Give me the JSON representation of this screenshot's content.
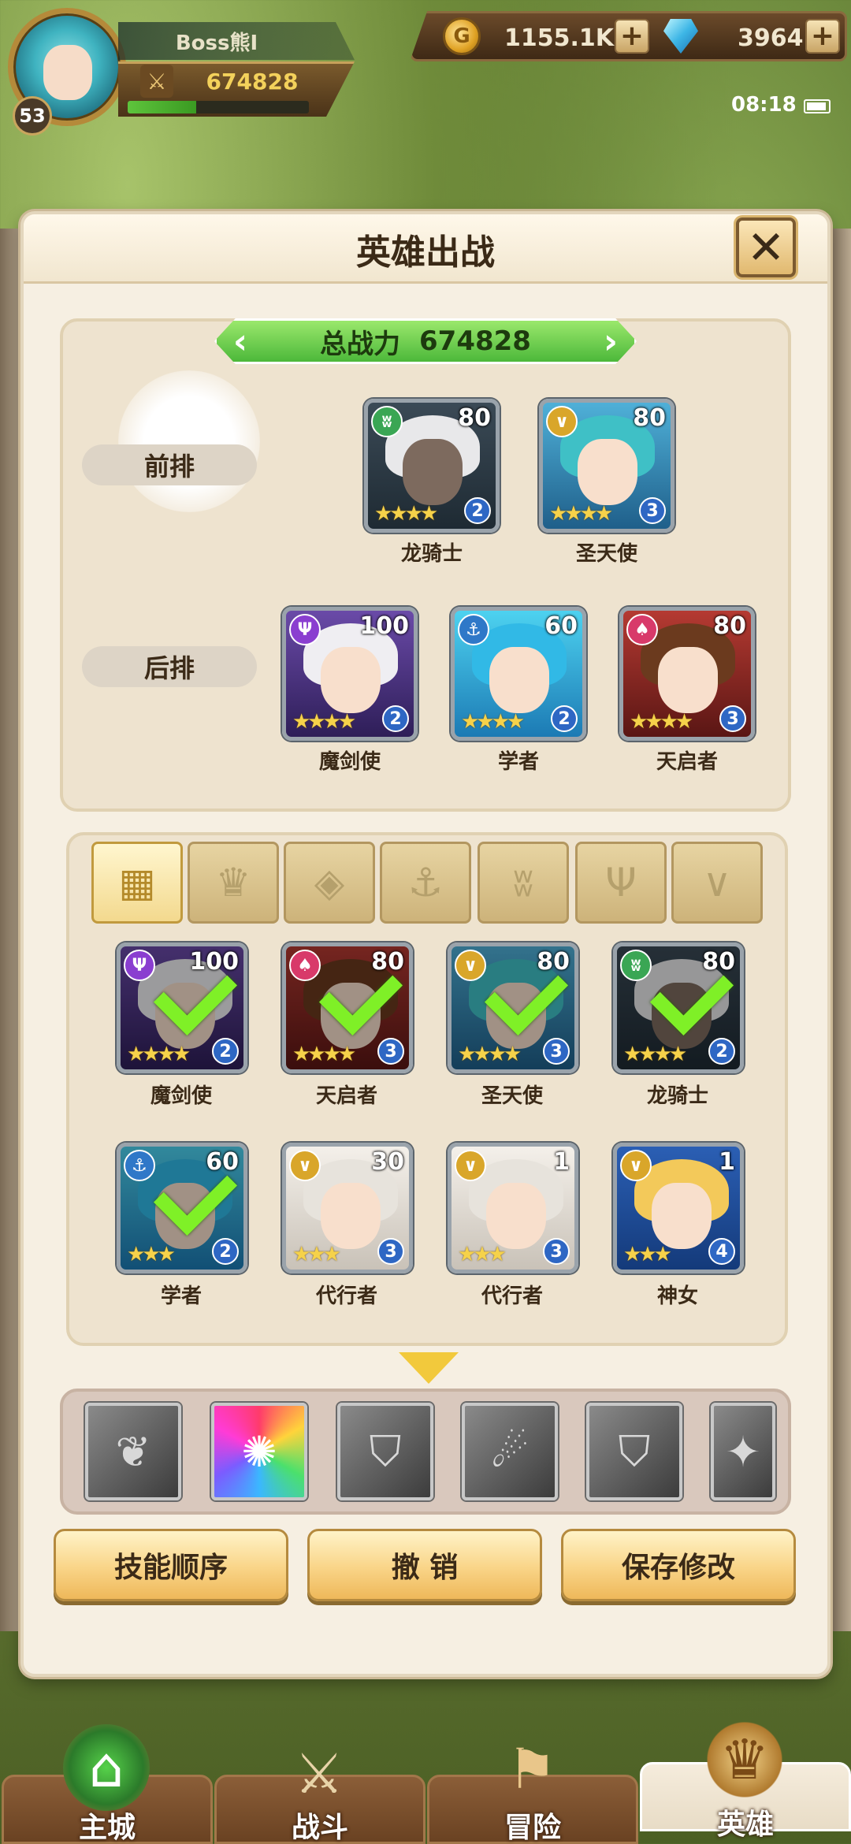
{
  "player": {
    "name": "Boss熊I",
    "level": "53",
    "power": "674828",
    "exp_fraction": 0.38
  },
  "currency": {
    "gold": "1155.1K",
    "gold_icon": "G",
    "gems": "3964"
  },
  "status": {
    "time": "08:18"
  },
  "dialog": {
    "title": "英雄出战",
    "close": "✕",
    "total_power_label": "总战力",
    "total_power_value": "674828",
    "front_label": "前排",
    "back_label": "后排"
  },
  "formation": {
    "front": [
      {
        "name": "龙骑士",
        "level": "80",
        "rank": "2",
        "stars": "★★★★",
        "elem": "ʬ"
      },
      {
        "name": "圣天使",
        "level": "80",
        "rank": "3",
        "stars": "★★★★",
        "elem": "∨"
      }
    ],
    "back": [
      {
        "name": "魔剑使",
        "level": "100",
        "rank": "2",
        "stars": "★★★★",
        "elem": "Ψ"
      },
      {
        "name": "学者",
        "level": "60",
        "rank": "2",
        "stars": "★★★★",
        "elem": "⚓"
      },
      {
        "name": "天启者",
        "level": "80",
        "rank": "3",
        "stars": "★★★★",
        "elem": "♠"
      }
    ]
  },
  "filters": [
    "▦",
    "♛",
    "◈",
    "⚓",
    "ʬ",
    "Ψ",
    "∨"
  ],
  "roster": [
    {
      "name": "魔剑使",
      "level": "100",
      "rank": "2",
      "stars": "★★★★",
      "elem": "Ψ"
    },
    {
      "name": "天启者",
      "level": "80",
      "rank": "3",
      "stars": "★★★★",
      "elem": "♠"
    },
    {
      "name": "圣天使",
      "level": "80",
      "rank": "3",
      "stars": "★★★★",
      "elem": "∨"
    },
    {
      "name": "龙骑士",
      "level": "80",
      "rank": "2",
      "stars": "★★★★",
      "elem": "ʬ"
    },
    {
      "name": "学者",
      "level": "60",
      "rank": "2",
      "stars": "★★★",
      "elem": "⚓"
    },
    {
      "name": "代行者",
      "level": "30",
      "rank": "3",
      "stars": "★★★",
      "elem": "∨"
    },
    {
      "name": "代行者",
      "level": "1",
      "rank": "3",
      "stars": "★★★",
      "elem": "∨"
    },
    {
      "name": "神女",
      "level": "1",
      "rank": "4",
      "stars": "★★★",
      "elem": "∨"
    }
  ],
  "skills": [
    "❦",
    "✺",
    "⛉",
    "☄",
    "⛉",
    "✦"
  ],
  "buttons": {
    "order": "技能顺序",
    "undo": "撤 销",
    "save": "保存修改"
  },
  "nav": [
    {
      "label": "主城",
      "icon": "⌂"
    },
    {
      "label": "战斗",
      "icon": "⚔"
    },
    {
      "label": "冒险",
      "icon": "⚑"
    },
    {
      "label": "英雄",
      "icon": "♛"
    }
  ]
}
